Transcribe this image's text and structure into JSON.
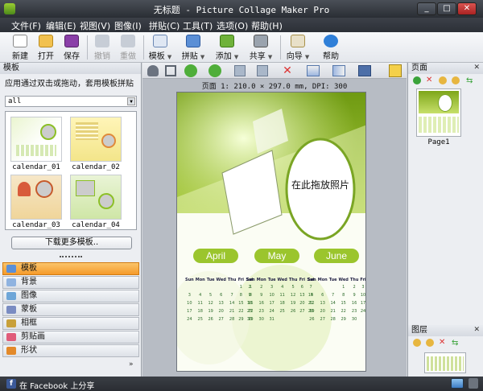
{
  "window": {
    "title": "无标题 - Picture Collage Maker Pro",
    "minimize": "_",
    "restore": "□",
    "close": "✕"
  },
  "menu": [
    "文件(F)",
    "编辑(E)",
    "视图(V)",
    "图像(I)",
    "拼贴(C)",
    "工具(T)",
    "选项(O)",
    "帮助(H)"
  ],
  "toolbar": {
    "new": "新建",
    "open": "打开",
    "save": "保存",
    "undo": "撤销",
    "redo": "重做",
    "template": "模板",
    "collage": "拼贴",
    "add": "添加",
    "share": "共享",
    "wizard": "向导",
    "help": "帮助"
  },
  "left": {
    "header": "模板",
    "hint": "应用通过双击或拖动，套用模板拼贴",
    "filter_value": "all",
    "thumbs": [
      "calendar_01",
      "calendar_02",
      "calendar_03",
      "calendar_04"
    ],
    "download_btn": "下载更多模板..",
    "categories": [
      "模板",
      "背景",
      "图像",
      "蒙板",
      "相框",
      "剪贴画",
      "形状"
    ]
  },
  "canvas": {
    "page_info": "页面 1: 210.0 × 297.0 mm, DPI: 300",
    "drop_text": "在此拖放照片",
    "months": [
      "April",
      "May",
      "June"
    ],
    "weekdays": [
      "Sun",
      "Mon",
      "Tue",
      "Wed",
      "Thu",
      "Fri",
      "Sat"
    ],
    "april": [
      [
        "",
        "",
        "",
        "",
        "",
        "1",
        "2"
      ],
      [
        "3",
        "4",
        "5",
        "6",
        "7",
        "8",
        "9"
      ],
      [
        "10",
        "11",
        "12",
        "13",
        "14",
        "15",
        "16"
      ],
      [
        "17",
        "18",
        "19",
        "20",
        "21",
        "22",
        "23"
      ],
      [
        "24",
        "25",
        "26",
        "27",
        "28",
        "29",
        "30"
      ]
    ],
    "may": [
      [
        "1",
        "2",
        "3",
        "4",
        "5",
        "6",
        "7"
      ],
      [
        "8",
        "9",
        "10",
        "11",
        "12",
        "13",
        "14"
      ],
      [
        "15",
        "16",
        "17",
        "18",
        "19",
        "20",
        "21"
      ],
      [
        "22",
        "23",
        "24",
        "25",
        "26",
        "27",
        "28"
      ],
      [
        "29",
        "30",
        "31",
        "",
        "",
        "",
        ""
      ]
    ],
    "june": [
      [
        "",
        "",
        "",
        "1",
        "2",
        "3",
        "4"
      ],
      [
        "5",
        "6",
        "7",
        "8",
        "9",
        "10",
        "11"
      ],
      [
        "12",
        "13",
        "14",
        "15",
        "16",
        "17",
        "18"
      ],
      [
        "19",
        "20",
        "21",
        "22",
        "23",
        "24",
        "25"
      ],
      [
        "26",
        "27",
        "28",
        "29",
        "30",
        "",
        ""
      ]
    ]
  },
  "right": {
    "pages_header": "页面",
    "page1": "Page1",
    "layers_header": "图层"
  },
  "status": {
    "facebook": "在 Facebook 上分享"
  },
  "colors": {
    "accent_orange": "#f6a33b",
    "green": "#8cbf26",
    "dark": "#2c3037"
  }
}
